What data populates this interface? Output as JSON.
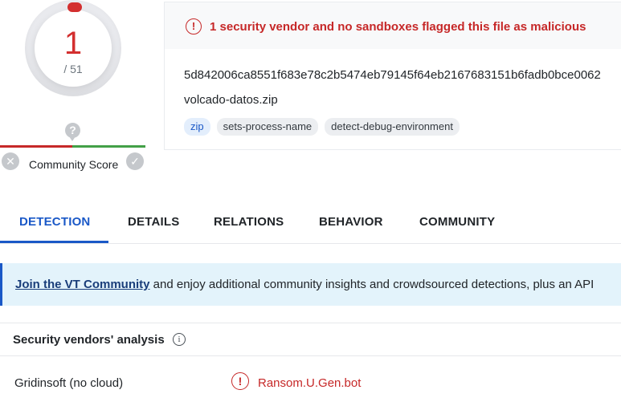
{
  "score": {
    "detections": "1",
    "total": "/ 51",
    "community_label": "Community Score",
    "question_glyph": "?",
    "x_glyph": "✕",
    "check_glyph": "✓"
  },
  "summary": {
    "alert": "1 security vendor and no sandboxes flagged this file as malicious",
    "alert_glyph": "!",
    "hash": "5d842006ca8551f683e78c2b5474eb79145f64eb2167683151b6fadb0bce0062",
    "filename": "volcado-datos.zip",
    "tags": [
      "zip",
      "sets-process-name",
      "detect-debug-environment"
    ]
  },
  "tabs": [
    "DETECTION",
    "DETAILS",
    "RELATIONS",
    "BEHAVIOR",
    "COMMUNITY"
  ],
  "banner": {
    "link": "Join the VT Community",
    "text": " and enjoy additional community insights and crowdsourced detections, plus an API"
  },
  "vendors": {
    "title": "Security vendors' analysis",
    "info_glyph": "i",
    "rows": [
      {
        "name": "Gridinsoft (no cloud)",
        "result": "Ransom.U.Gen.bot",
        "glyph": "!"
      }
    ]
  },
  "colors": {
    "malicious": "#c62828",
    "accent": "#1a58c7",
    "community_good": "#43a047"
  }
}
